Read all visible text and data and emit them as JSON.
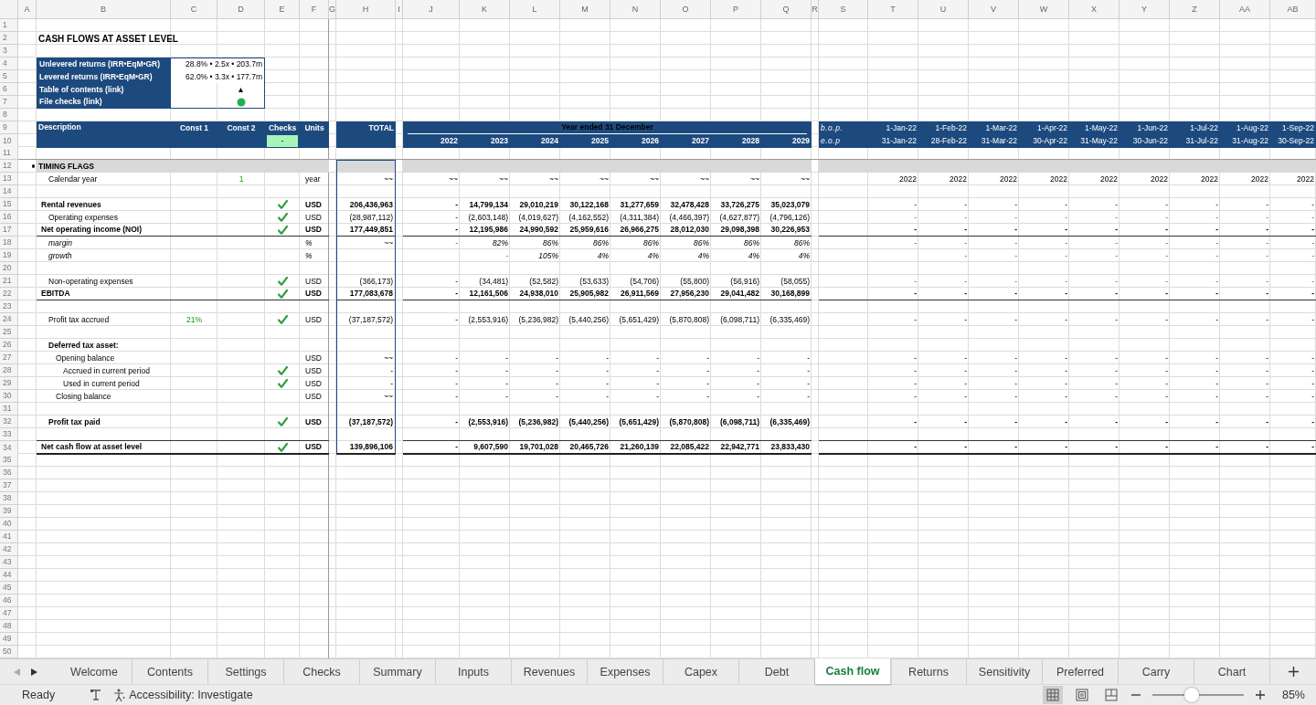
{
  "columns": [
    "A",
    "B",
    "C",
    "D",
    "E",
    "F",
    "G",
    "H",
    "I",
    "J",
    "K",
    "L",
    "M",
    "N",
    "O",
    "P",
    "Q",
    "R",
    "S",
    "T",
    "U",
    "V",
    "W",
    "X",
    "Y",
    "Z",
    "AA",
    "AB"
  ],
  "row_numbers": [
    "1",
    "2",
    "3",
    "4",
    "5",
    "6",
    "7",
    "8",
    "9",
    "10",
    "11",
    "12",
    "13",
    "14",
    "15",
    "16",
    "17",
    "18",
    "19",
    "20",
    "21",
    "22",
    "23",
    "24",
    "25",
    "26",
    "27",
    "28",
    "29",
    "30",
    "31",
    "32",
    "33",
    "34",
    "35",
    "36",
    "37",
    "38",
    "39",
    "40",
    "41",
    "42",
    "43",
    "44",
    "45",
    "46",
    "47",
    "48",
    "49",
    "50"
  ],
  "title": "CASH FLOWS AT ASSET LEVEL",
  "summary": [
    {
      "kind": "text",
      "label": "Unlevered returns (IRR•EqM•GR)",
      "value": "28.8% • 2.5x • 203.7m"
    },
    {
      "kind": "text",
      "label": "Levered returns (IRR•EqM•GR)",
      "value": "62.0% • 3.3x • 177.7m"
    },
    {
      "kind": "link",
      "label": "Table of contents (link)",
      "value": "▲"
    },
    {
      "kind": "status",
      "label": "File checks (link)",
      "ok": true
    }
  ],
  "header": {
    "description": "Description",
    "const1": "Const 1",
    "const2": "Const 2",
    "checks": "Checks",
    "checks_value": "-",
    "checks_ok": true,
    "units": "Units",
    "total": "TOTAL",
    "period": "Year ended 31 December",
    "years": [
      "2022",
      "2023",
      "2024",
      "2025",
      "2026",
      "2027",
      "2028",
      "2029"
    ],
    "bop": "b.o.p.",
    "eop": "e.o.p",
    "month_starts": [
      "1-Jan-22",
      "1-Feb-22",
      "1-Mar-22",
      "1-Apr-22",
      "1-May-22",
      "1-Jun-22",
      "1-Jul-22",
      "1-Aug-22",
      "1-Sep-22"
    ],
    "month_ends": [
      "31-Jan-22",
      "28-Feb-22",
      "31-Mar-22",
      "30-Apr-22",
      "31-May-22",
      "30-Jun-22",
      "31-Jul-22",
      "31-Aug-22",
      "30-Sep-22"
    ]
  },
  "rows": [
    {
      "kind": "section",
      "label": "TIMING FLAGS"
    },
    {
      "kind": "line",
      "label": "Calendar year",
      "const2": "1",
      "checked": false,
      "units": "year",
      "total": "~~",
      "annual": [
        "~~",
        "~~",
        "~~",
        "~~",
        "~~",
        "~~",
        "~~",
        "~~"
      ],
      "monthly": [
        "2022",
        "2022",
        "2022",
        "2022",
        "2022",
        "2022",
        "2022",
        "2022",
        "2022"
      ],
      "monthly_input": false
    },
    {
      "kind": "blank"
    },
    {
      "kind": "main",
      "label": "Rental revenues",
      "checked": true,
      "units": "USD",
      "total": "206,436,963",
      "annual": [
        "-",
        "14,799,134",
        "29,010,219",
        "30,122,168",
        "31,277,659",
        "32,478,428",
        "33,726,275",
        "35,023,079"
      ],
      "monthly": [
        "-",
        "-",
        "-",
        "-",
        "-",
        "-",
        "-",
        "-",
        "-"
      ],
      "monthly_input": true
    },
    {
      "kind": "line",
      "label": "Operating expenses",
      "checked": true,
      "units": "USD",
      "total": "(28,987,112)",
      "annual": [
        "-",
        "(2,603,148)",
        "(4,019,627)",
        "(4,162,552)",
        "(4,311,384)",
        "(4,466,397)",
        "(4,627,877)",
        "(4,796,126)"
      ],
      "monthly": [
        "-",
        "-",
        "-",
        "-",
        "-",
        "-",
        "-",
        "-",
        "-"
      ],
      "monthly_input": true
    },
    {
      "kind": "subtotal",
      "label": "Net operating income (NOI)",
      "checked": true,
      "units": "USD",
      "total": "177,449,851",
      "annual": [
        "-",
        "12,195,986",
        "24,990,592",
        "25,959,616",
        "26,966,275",
        "28,012,030",
        "29,098,398",
        "30,226,953"
      ],
      "monthly": [
        "-",
        "-",
        "-",
        "-",
        "-",
        "-",
        "-",
        "-",
        "-"
      ],
      "monthly_input": false
    },
    {
      "kind": "ratio",
      "label": "margin",
      "checked": false,
      "units": "%",
      "total": "~~",
      "annual": [
        "-",
        "82%",
        "86%",
        "86%",
        "86%",
        "86%",
        "86%",
        "86%"
      ],
      "monthly": [
        "-",
        "-",
        "-",
        "-",
        "-",
        "-",
        "-",
        "-",
        "-"
      ],
      "monthly_input": false
    },
    {
      "kind": "ratio",
      "label": "growth",
      "checked": false,
      "units": "%",
      "annual": [
        "-",
        "105%",
        "4%",
        "4%",
        "4%",
        "4%",
        "4%"
      ],
      "monthly": [
        "-",
        "-",
        "-",
        "-",
        "-",
        "-",
        "-",
        "-"
      ],
      "monthly_input": false
    },
    {
      "kind": "blank"
    },
    {
      "kind": "line",
      "label": "Non-operating expenses",
      "checked": true,
      "units": "USD",
      "total": "(366,173)",
      "annual": [
        "-",
        "(34,481)",
        "(52,582)",
        "(53,633)",
        "(54,706)",
        "(55,800)",
        "(56,916)",
        "(58,055)"
      ],
      "monthly": [
        "-",
        "-",
        "-",
        "-",
        "-",
        "-",
        "-",
        "-",
        "-"
      ],
      "monthly_input": true
    },
    {
      "kind": "subtotal",
      "label": "EBITDA",
      "checked": true,
      "units": "USD",
      "total": "177,083,678",
      "annual": [
        "-",
        "12,161,506",
        "24,938,010",
        "25,905,982",
        "26,911,569",
        "27,956,230",
        "29,041,482",
        "30,168,899"
      ],
      "monthly": [
        "-",
        "-",
        "-",
        "-",
        "-",
        "-",
        "-",
        "-",
        "-"
      ],
      "monthly_input": false
    },
    {
      "kind": "blank"
    },
    {
      "kind": "line",
      "label": "Profit tax accrued",
      "const1": "21%",
      "checked": true,
      "units": "USD",
      "total": "(37,187,572)",
      "annual": [
        "-",
        "(2,553,916)",
        "(5,236,982)",
        "(5,440,256)",
        "(5,651,429)",
        "(5,870,808)",
        "(6,098,711)",
        "(6,335,469)"
      ],
      "monthly": [
        "-",
        "-",
        "-",
        "-",
        "-",
        "-",
        "-",
        "-",
        "-"
      ],
      "monthly_input": false
    },
    {
      "kind": "blank"
    },
    {
      "kind": "heading",
      "label": "Deferred tax asset:",
      "checked": false
    },
    {
      "kind": "detail",
      "label": "Opening balance",
      "checked": false,
      "units": "USD",
      "total": "~~",
      "annual": [
        "-",
        "-",
        "-",
        "-",
        "-",
        "-",
        "-",
        "-"
      ],
      "monthly": [
        "-",
        "-",
        "-",
        "-",
        "-",
        "-",
        "-",
        "-",
        "-"
      ],
      "monthly_input": false
    },
    {
      "kind": "subdetail",
      "label": "Accrued in current period",
      "checked": true,
      "units": "USD",
      "total": "-",
      "annual": [
        "-",
        "-",
        "-",
        "-",
        "-",
        "-",
        "-",
        "-"
      ],
      "monthly": [
        "-",
        "-",
        "-",
        "-",
        "-",
        "-",
        "-",
        "-",
        "-"
      ],
      "monthly_input": false
    },
    {
      "kind": "subdetail",
      "label": "Used in current period",
      "checked": true,
      "units": "USD",
      "total": "-",
      "annual": [
        "-",
        "-",
        "-",
        "-",
        "-",
        "-",
        "-",
        "-"
      ],
      "monthly": [
        "-",
        "-",
        "-",
        "-",
        "-",
        "-",
        "-",
        "-",
        "-"
      ],
      "monthly_input": false
    },
    {
      "kind": "detail",
      "label": "Closing balance",
      "checked": false,
      "units": "USD",
      "total": "~~",
      "annual": [
        "-",
        "-",
        "-",
        "-",
        "-",
        "-",
        "-",
        "-"
      ],
      "monthly": [
        "-",
        "-",
        "-",
        "-",
        "-",
        "-",
        "-",
        "-",
        "-"
      ],
      "monthly_input": false
    },
    {
      "kind": "blank"
    },
    {
      "kind": "keyline",
      "label": "Profit tax paid",
      "checked": true,
      "units": "USD",
      "total": "(37,187,572)",
      "annual": [
        "-",
        "(2,553,916)",
        "(5,236,982)",
        "(5,440,256)",
        "(5,651,429)",
        "(5,870,808)",
        "(6,098,711)",
        "(6,335,469)"
      ],
      "monthly": [
        "-",
        "-",
        "-",
        "-",
        "-",
        "-",
        "-",
        "-",
        "-"
      ],
      "monthly_input": false
    },
    {
      "kind": "blank"
    },
    {
      "kind": "grandtotal",
      "label": "Net cash flow at asset level",
      "checked": true,
      "units": "USD",
      "total": "139,896,106",
      "annual": [
        "-",
        "9,607,590",
        "19,701,028",
        "20,465,726",
        "21,260,139",
        "22,085,422",
        "22,942,771",
        "23,833,430"
      ],
      "monthly": [
        "-",
        "-",
        "-",
        "-",
        "-",
        "-",
        "-",
        "-",
        "-"
      ],
      "monthly_input": false
    }
  ],
  "tabs": [
    {
      "label": "Welcome",
      "selected": false
    },
    {
      "label": "Contents",
      "selected": false
    },
    {
      "label": "Settings",
      "selected": false
    },
    {
      "label": "Checks",
      "selected": false
    },
    {
      "label": "Summary",
      "selected": false
    },
    {
      "label": "Inputs",
      "selected": false
    },
    {
      "label": "Revenues",
      "selected": false
    },
    {
      "label": "Expenses",
      "selected": false
    },
    {
      "label": "Capex",
      "selected": false
    },
    {
      "label": "Debt",
      "selected": false
    },
    {
      "label": "Cash flow",
      "selected": true
    },
    {
      "label": "Returns",
      "selected": false
    },
    {
      "label": "Sensitivity",
      "selected": false
    },
    {
      "label": "Preferred",
      "selected": false
    },
    {
      "label": "Carry",
      "selected": false
    },
    {
      "label": "Chart",
      "selected": false
    }
  ],
  "status_bar": {
    "status": "Ready",
    "accessibility": "Accessibility: Investigate",
    "views": [
      {
        "kind": "normal",
        "selected": true
      },
      {
        "kind": "page_layout",
        "selected": false
      },
      {
        "kind": "page_break",
        "selected": false
      }
    ],
    "zoom": {
      "level": 0.43,
      "reading": "85%"
    }
  }
}
